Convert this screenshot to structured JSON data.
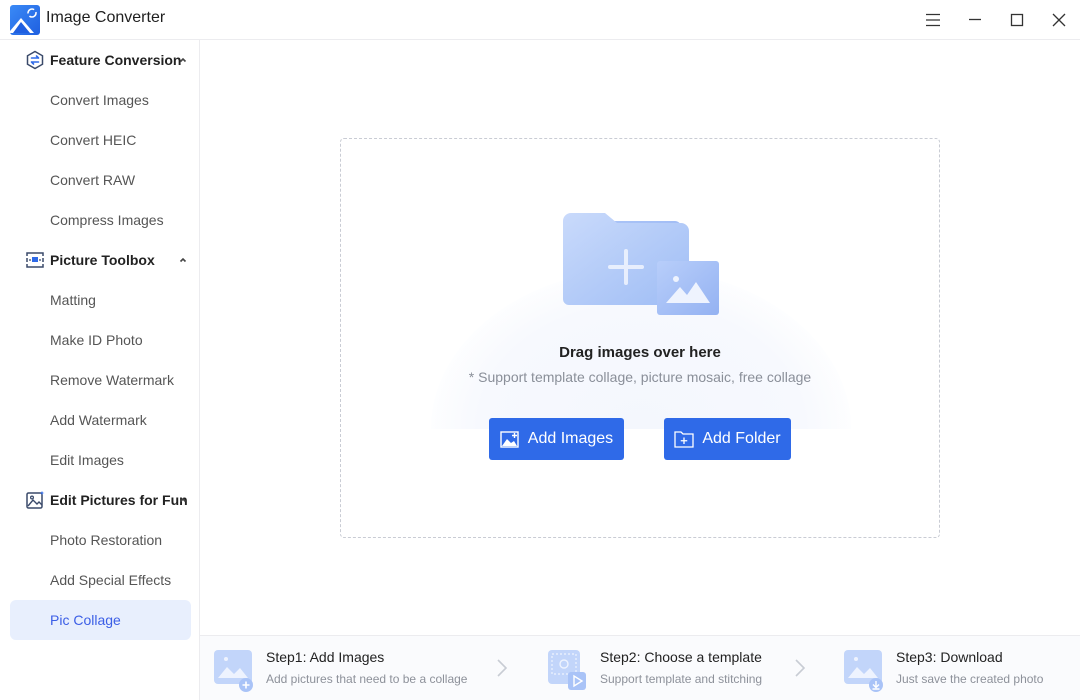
{
  "app": {
    "title": "Image Converter",
    "logo_icon": "image-converter-logo",
    "window_controls": [
      "menu-icon",
      "minimize-icon",
      "maximize-icon",
      "close-icon"
    ]
  },
  "sidebar": {
    "groups": [
      {
        "label": "Feature Conversion",
        "icon": "convert-arrows-icon",
        "expanded": true,
        "items": [
          {
            "label": "Convert Images"
          },
          {
            "label": "Convert HEIC"
          },
          {
            "label": "Convert RAW"
          },
          {
            "label": "Compress Images"
          }
        ]
      },
      {
        "label": "Picture Toolbox",
        "icon": "toolbox-icon",
        "expanded": true,
        "items": [
          {
            "label": "Matting"
          },
          {
            "label": "Make ID Photo"
          },
          {
            "label": "Remove Watermark"
          },
          {
            "label": "Add Watermark"
          },
          {
            "label": "Edit Images"
          }
        ]
      },
      {
        "label": "Edit Pictures for Fun",
        "icon": "fun-picture-icon",
        "expanded": true,
        "items": [
          {
            "label": "Photo Restoration"
          },
          {
            "label": "Add Special Effects"
          },
          {
            "label": "Pic Collage",
            "active": true
          }
        ]
      }
    ]
  },
  "dropzone": {
    "title": "Drag images over here",
    "subtitle": "* Support template collage, picture mosaic, free collage",
    "add_images_label": "Add Images",
    "add_folder_label": "Add Folder"
  },
  "steps": [
    {
      "title": "Step1:  Add Images",
      "desc": "Add pictures that need to be a collage",
      "icon": "add-image-step-icon"
    },
    {
      "title": "Step2:  Choose a template",
      "desc": "Support template and stitching",
      "icon": "template-step-icon"
    },
    {
      "title": "Step3:  Download",
      "desc": "Just save the created photo",
      "icon": "download-step-icon"
    }
  ],
  "colors": {
    "accent": "#2f6ae8",
    "active_bg": "#e8effd",
    "active_text": "#3b5ee6",
    "border": "#ececef"
  }
}
